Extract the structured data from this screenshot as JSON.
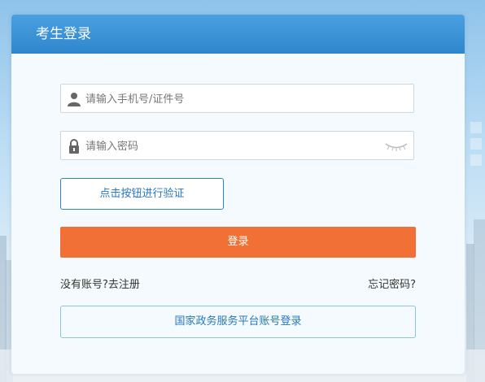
{
  "header": {
    "title": "考生登录"
  },
  "form": {
    "account": {
      "placeholder": "请输入手机号/证件号",
      "icon": "user-icon"
    },
    "password": {
      "placeholder": "请输入密码",
      "icon": "lock-icon",
      "toggle_icon": "eye-closed-icon"
    },
    "verify_label": "点击按钮进行验证",
    "login_label": "登录",
    "no_account_text": "没有账号?",
    "register_label": "去注册",
    "forgot_label": "忘记密码?",
    "gov_login_label": "国家政务服务平台账号登录"
  },
  "colors": {
    "header_blue": "#2f86cc",
    "login_orange": "#f07035",
    "link_blue": "#2678c0"
  }
}
